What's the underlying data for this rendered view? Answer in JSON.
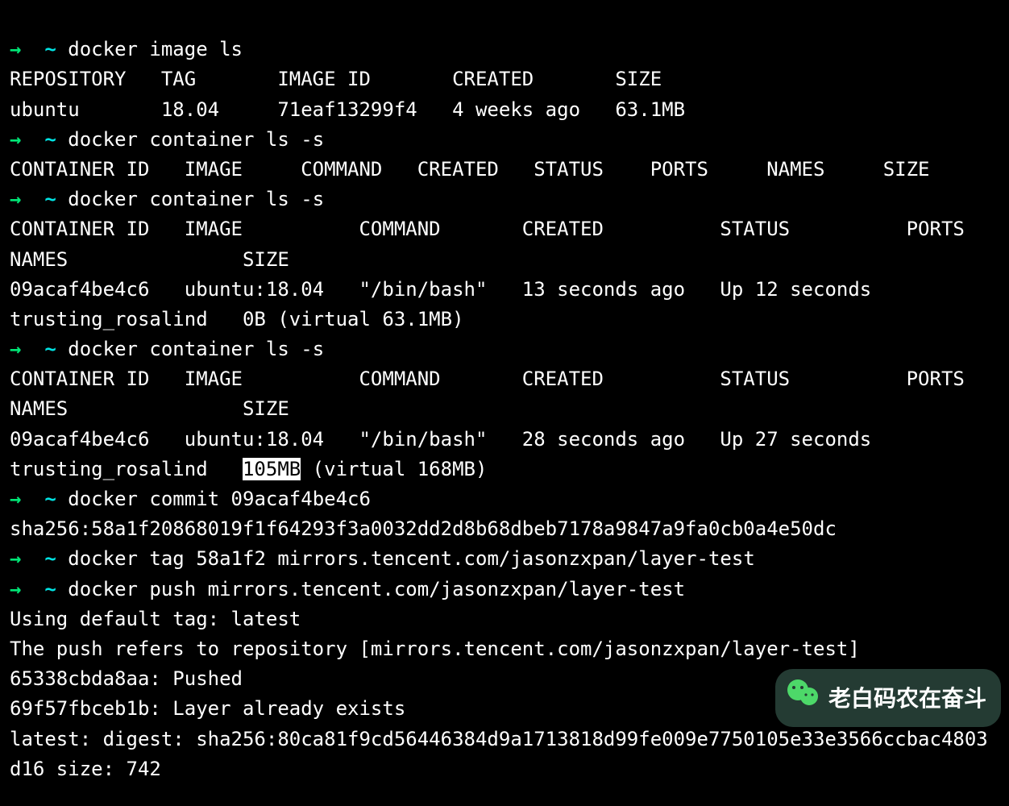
{
  "prompt": {
    "arrow": "→",
    "tilde": "~"
  },
  "cmds": {
    "c1": "docker image ls",
    "c2": "docker container ls -s",
    "c3": "docker container ls -s",
    "c4": "docker container ls -s",
    "c5": "docker commit 09acaf4be4c6",
    "c6": "docker tag 58a1f2 mirrors.tencent.com/jasonzxpan/layer-test",
    "c7": "docker push mirrors.tencent.com/jasonzxpan/layer-test"
  },
  "out": {
    "img_header": "REPOSITORY   TAG       IMAGE ID       CREATED       SIZE",
    "img_row": "ubuntu       18.04     71eaf13299f4   4 weeks ago   63.1MB",
    "c2_header": "CONTAINER ID   IMAGE     COMMAND   CREATED   STATUS    PORTS     NAMES     SIZE",
    "c3_header_l1": "CONTAINER ID   IMAGE          COMMAND       CREATED          STATUS          PORTS     NAMES               SIZE",
    "c3_row": "09acaf4be4c6   ubuntu:18.04   \"/bin/bash\"   13 seconds ago   Up 12 seconds             trusting_rosalind   0B (virtual 63.1MB)",
    "c4_header_l1": "CONTAINER ID   IMAGE          COMMAND       CREATED          STATUS          PORTS     NAMES               SIZE",
    "c4_row_pre": "09acaf4be4c6   ubuntu:18.04   \"/bin/bash\"   28 seconds ago   Up 27 seconds             trusting_rosalind   ",
    "c4_row_hl": "105MB",
    "c4_row_post": " (virtual 168MB)",
    "sha": "sha256:58a1f20868019f1f64293f3a0032dd2d8b68dbeb7178a9847a9fa0cb0a4e50dc",
    "push_l1": "Using default tag: latest",
    "push_l2": "The push refers to repository [mirrors.tencent.com/jasonzxpan/layer-test]",
    "push_l3": "65338cbda8aa: Pushed",
    "push_l4": "69f57fbceb1b: Layer already exists",
    "push_l5": "latest: digest: sha256:80ca81f9cd56446384d9a1713818d99fe009e7750105e33e3566ccbac4803d16 size: 742"
  },
  "badge": {
    "text": "老白码农在奋斗"
  }
}
